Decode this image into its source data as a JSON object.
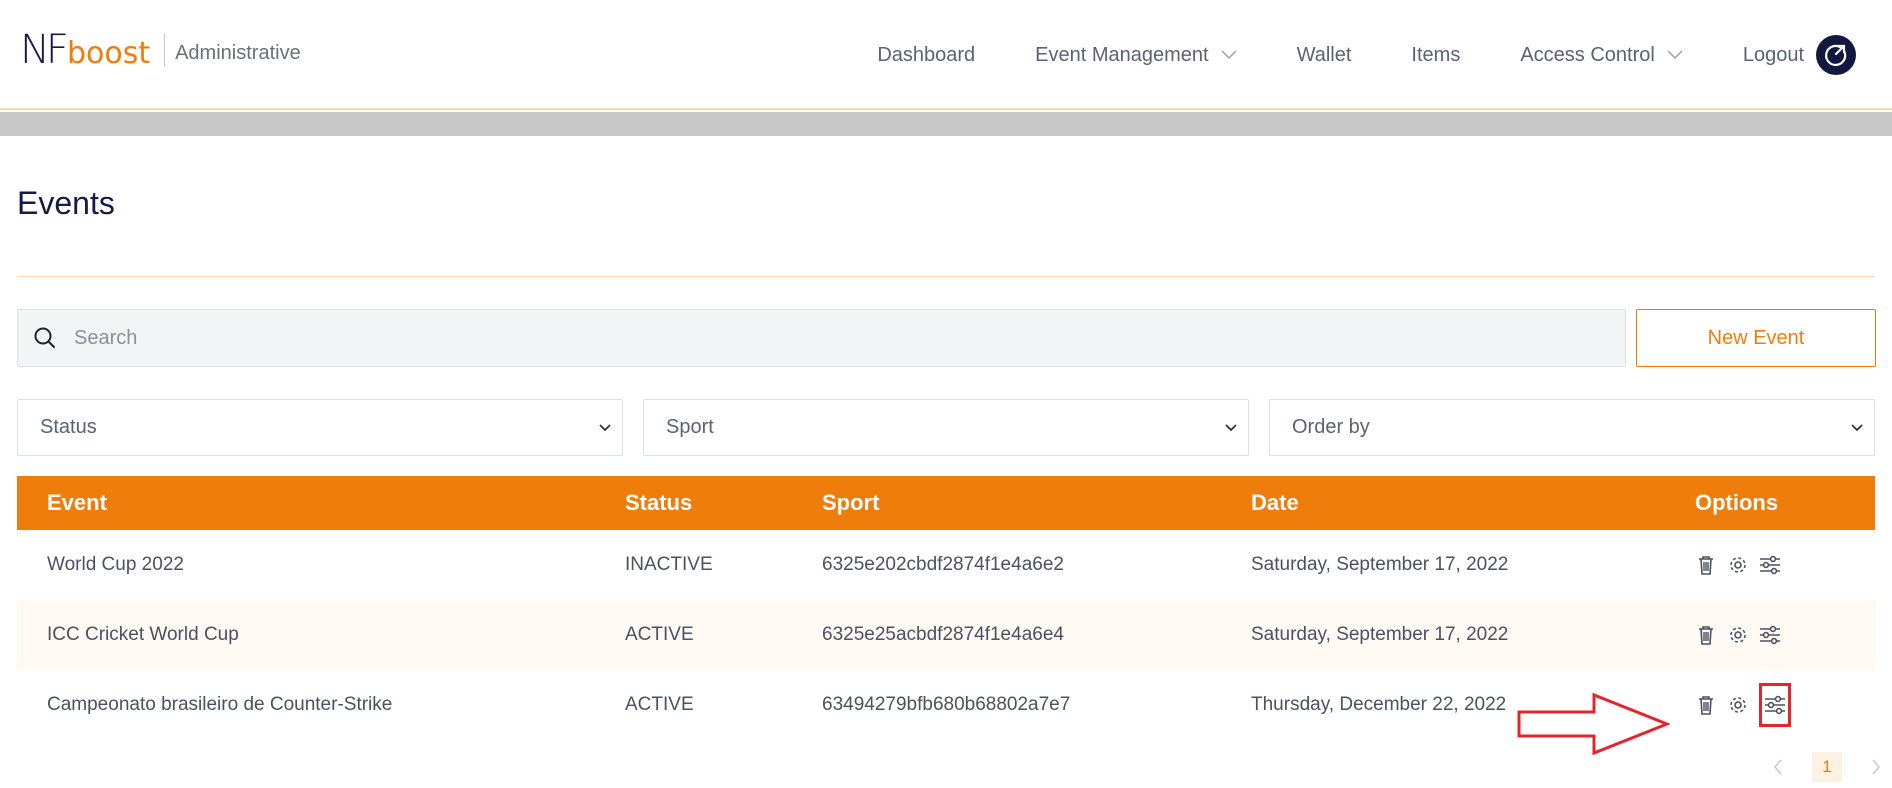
{
  "brand": {
    "logo_primary": "NF",
    "logo_secondary": "boost",
    "section": "Administrative",
    "primary_color": "#161a4a",
    "accent_color": "#ef7d0b"
  },
  "nav": {
    "items": [
      {
        "label": "Dashboard",
        "dropdown": false
      },
      {
        "label": "Event Management",
        "dropdown": true
      },
      {
        "label": "Wallet",
        "dropdown": false
      },
      {
        "label": "Items",
        "dropdown": false
      },
      {
        "label": "Access Control",
        "dropdown": true
      },
      {
        "label": "Logout",
        "dropdown": false
      }
    ],
    "logout_icon": "power-icon"
  },
  "page": {
    "title": "Events"
  },
  "search": {
    "placeholder": "Search",
    "value": ""
  },
  "actions": {
    "new_event": "New Event"
  },
  "filters": [
    {
      "label": "Status"
    },
    {
      "label": "Sport"
    },
    {
      "label": "Order by"
    }
  ],
  "table": {
    "headers": {
      "event": "Event",
      "status": "Status",
      "sport": "Sport",
      "date": "Date",
      "options": "Options"
    },
    "rows": [
      {
        "event": "World Cup 2022",
        "status": "INACTIVE",
        "sport": "6325e202cbdf2874f1e4a6e2",
        "date": "Saturday, September 17, 2022"
      },
      {
        "event": "ICC Cricket World Cup",
        "status": "ACTIVE",
        "sport": "6325e25acbdf2874f1e4a6e4",
        "date": "Saturday, September 17, 2022"
      },
      {
        "event": "Campeonato brasileiro de Counter-Strike",
        "status": "ACTIVE",
        "sport": "63494279bfb680b68802a7e7",
        "date": "Thursday, December 22, 2022"
      }
    ],
    "option_icons": [
      "trash-icon",
      "gear-icon",
      "sliders-icon"
    ]
  },
  "annotation": {
    "highlight_color": "#e3262e",
    "target": "sliders-icon row 3"
  },
  "pagination": {
    "current_page": "1"
  }
}
